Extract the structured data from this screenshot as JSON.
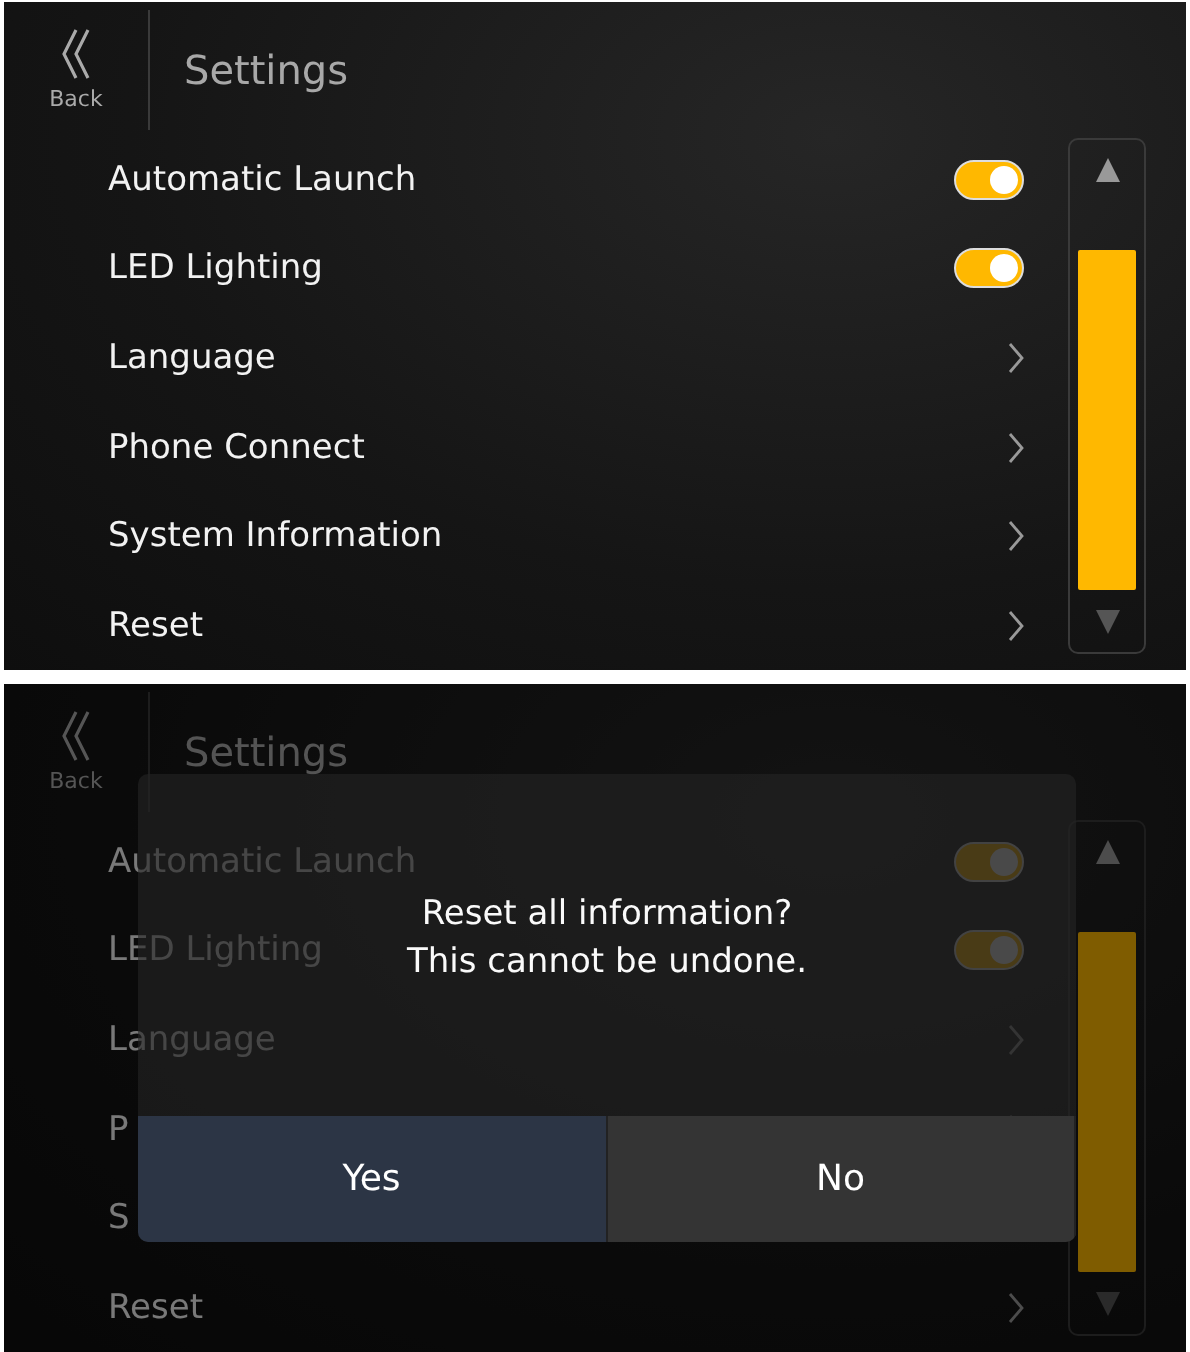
{
  "screens": [
    {
      "header": {
        "back_label": "Back",
        "title": "Settings"
      },
      "items": [
        {
          "label": "Automatic Launch",
          "kind": "toggle",
          "on": true
        },
        {
          "label": "LED Lighting",
          "kind": "toggle",
          "on": true
        },
        {
          "label": "Language",
          "kind": "link"
        },
        {
          "label": "Phone Connect",
          "kind": "link"
        },
        {
          "label": "System Information",
          "kind": "link"
        },
        {
          "label": "Reset",
          "kind": "link"
        }
      ]
    },
    {
      "header": {
        "back_label": "Back",
        "title": "Settings"
      },
      "items": [
        {
          "label": "Automatic Launch",
          "kind": "toggle",
          "on": true
        },
        {
          "label": "LED Lighting",
          "kind": "toggle",
          "on": true
        },
        {
          "label": "Language",
          "kind": "link"
        },
        {
          "label": "P",
          "kind": "link"
        },
        {
          "label": "S",
          "kind": "text"
        },
        {
          "label": "Reset",
          "kind": "link"
        }
      ],
      "dialog": {
        "message_lines": [
          "Reset all information?",
          "This cannot be undone."
        ],
        "buttons": [
          {
            "label": "Yes",
            "selected": true
          },
          {
            "label": "No",
            "selected": false
          }
        ]
      }
    }
  ]
}
